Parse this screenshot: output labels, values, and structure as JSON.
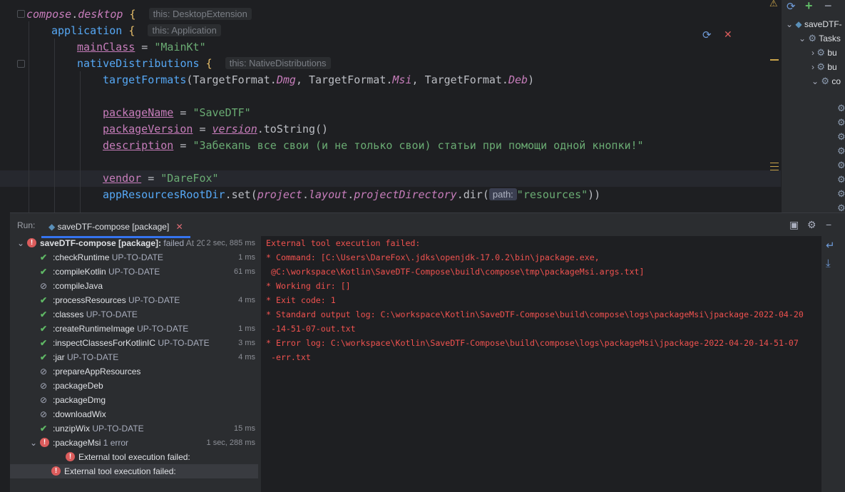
{
  "editor": {
    "line1": {
      "obj": "compose",
      "dot": ".",
      "prop": "desktop",
      "brace": " {",
      "hint": "this: DesktopExtension"
    },
    "line2": {
      "fn": "application",
      "brace": " {",
      "hint": "this: Application"
    },
    "line3": {
      "prop": "mainClass",
      "eq": " = ",
      "str": "\"MainKt\""
    },
    "line4": {
      "fn": "nativeDistributions",
      "brace": " {",
      "hint": "this: NativeDistributions"
    },
    "line5": {
      "fn": "targetFormats",
      "open": "(",
      "t1": "TargetFormat.",
      "e1": "Dmg",
      "c1": ", ",
      "t2": "TargetFormat.",
      "e2": "Msi",
      "c2": ", ",
      "t3": "TargetFormat.",
      "e3": "Deb",
      "close": ")"
    },
    "line6": {
      "prop": "packageName",
      "eq": " = ",
      "str": "\"SaveDTF\""
    },
    "line7": {
      "prop": "packageVersion",
      "eq": " = ",
      "ver": "version",
      "rest": ".toString()"
    },
    "line8": {
      "prop": "description",
      "eq": " = ",
      "str": "\"Забекапь все свои (и не только свои) статьи при помощи одной кнопки!\""
    },
    "line9": {
      "prop": "vendor",
      "eq": " = ",
      "str": "\"DareFox\""
    },
    "line10": {
      "fn": "appResourcesRootDir",
      "mid": ".set(",
      "p1": "project",
      "d1": ".",
      "p2": "layout",
      "d2": ".",
      "p3": "projectDirectory",
      "tail": ".dir(",
      "hint": "path:",
      "str": "\"resources\"",
      "close": "))"
    }
  },
  "editor_tools": {
    "gradle_icon": "gradle-refresh-icon",
    "close_icon": "close-icon",
    "warning_icon": "warning-icon"
  },
  "gradle": {
    "root": "saveDTF-",
    "tasks": "Tasks",
    "items": [
      "bu",
      "bu",
      "co"
    ]
  },
  "run": {
    "label": "Run:",
    "tab": "saveDTF-compose [package]",
    "tree": [
      {
        "kind": "err",
        "name": "saveDTF-compose [package]:",
        "status": " failed",
        "extra": " At 20.",
        "dur": "2 sec, 885 ms",
        "indent": 0,
        "bold": true
      },
      {
        "kind": "ok",
        "name": ":checkRuntime",
        "status": " UP-TO-DATE",
        "dur": "1 ms",
        "indent": 1
      },
      {
        "kind": "ok",
        "name": ":compileKotlin",
        "status": " UP-TO-DATE",
        "dur": "61 ms",
        "indent": 1
      },
      {
        "kind": "skip",
        "name": ":compileJava",
        "status": "",
        "dur": "",
        "indent": 1
      },
      {
        "kind": "ok",
        "name": ":processResources",
        "status": " UP-TO-DATE",
        "dur": "4 ms",
        "indent": 1
      },
      {
        "kind": "ok",
        "name": ":classes",
        "status": " UP-TO-DATE",
        "dur": "",
        "indent": 1
      },
      {
        "kind": "ok",
        "name": ":createRuntimeImage",
        "status": " UP-TO-DATE",
        "dur": "1 ms",
        "indent": 1
      },
      {
        "kind": "ok",
        "name": ":inspectClassesForKotlinIC",
        "status": " UP-TO-DATE",
        "dur": "3 ms",
        "indent": 1
      },
      {
        "kind": "ok",
        "name": ":jar",
        "status": " UP-TO-DATE",
        "dur": "4 ms",
        "indent": 1
      },
      {
        "kind": "skip",
        "name": ":prepareAppResources",
        "status": "",
        "dur": "",
        "indent": 1
      },
      {
        "kind": "skip",
        "name": ":packageDeb",
        "status": "",
        "dur": "",
        "indent": 1
      },
      {
        "kind": "skip",
        "name": ":packageDmg",
        "status": "",
        "dur": "",
        "indent": 1
      },
      {
        "kind": "skip",
        "name": ":downloadWix",
        "status": "",
        "dur": "",
        "indent": 1
      },
      {
        "kind": "ok",
        "name": ":unzipWix",
        "status": " UP-TO-DATE",
        "dur": "15 ms",
        "indent": 1
      },
      {
        "kind": "err",
        "name": ":packageMsi",
        "status": "  1 error",
        "dur": "1 sec, 288 ms",
        "indent": 1,
        "expanded": true
      },
      {
        "kind": "err",
        "name": "External tool execution failed:",
        "status": "",
        "dur": "",
        "indent": 2
      },
      {
        "kind": "err",
        "name": "External tool execution failed:",
        "status": "",
        "dur": "",
        "indent": 1,
        "selected": true
      }
    ],
    "console": [
      "External tool execution failed:",
      "* Command: [C:\\Users\\DareFox\\.jdks\\openjdk-17.0.2\\bin\\jpackage.exe,",
      " @C:\\workspace\\Kotlin\\SaveDTF-Compose\\build\\compose\\tmp\\packageMsi.args.txt]",
      "* Working dir: []",
      "* Exit code: 1",
      "* Standard output log: C:\\workspace\\Kotlin\\SaveDTF-Compose\\build\\compose\\logs\\packageMsi\\jpackage-2022-04-20",
      " -14-51-07-out.txt",
      "* Error log: C:\\workspace\\Kotlin\\SaveDTF-Compose\\build\\compose\\logs\\packageMsi\\jpackage-2022-04-20-14-51-07",
      " -err.txt"
    ]
  },
  "colors": {
    "accent": "#3574f0",
    "error": "#db5c5c",
    "ok": "#5fb865",
    "console_error": "#f0524f"
  }
}
